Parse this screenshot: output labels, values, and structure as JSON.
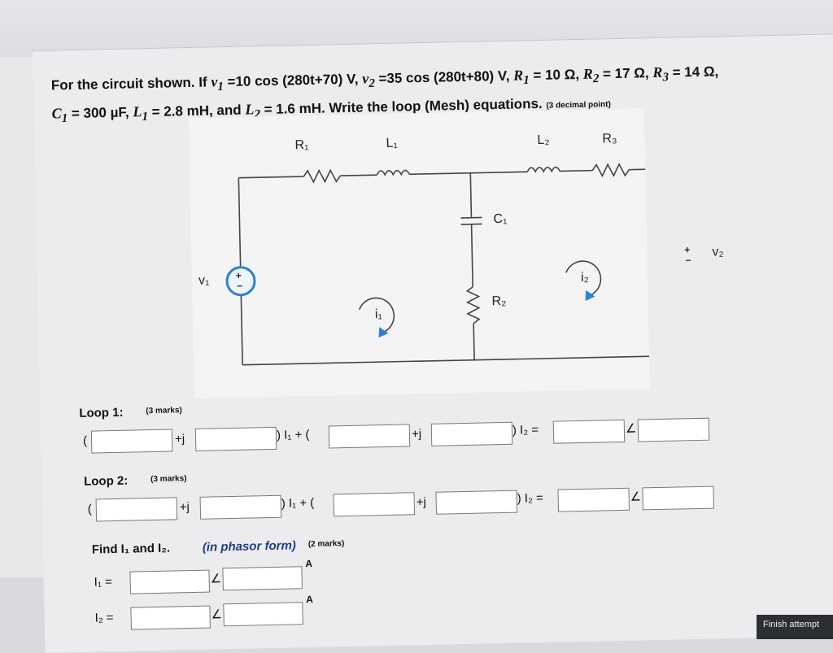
{
  "question": {
    "intro": "For the circuit shown. If",
    "v1_sym": "v",
    "v1_sub": "1",
    "v1_expr": "=10 cos (280t+70) V,",
    "v2_sym": "v",
    "v2_sub": "2",
    "v2_expr": "=35 cos (280t+80) V,",
    "R1_txt": "= 10 Ω,",
    "R2_txt": "= 17 Ω,",
    "R3_txt": "= 14 Ω,",
    "C1_txt": "= 300 µF,",
    "L1_txt": "= 2.8 mH, and",
    "L2_txt": "= 1.6 mH. Write the loop (Mesh) equations.",
    "decimal_note": "(3 decimal point)"
  },
  "circuit": {
    "R1": "R₁",
    "L1": "L₁",
    "L2": "L₂",
    "R3": "R₃",
    "C1": "C₁",
    "R2": "R₂",
    "v1": "v₁",
    "v2": "v₂",
    "i1": "i₁",
    "i2": "i₂",
    "plus": "+",
    "minus": "−"
  },
  "loop1": {
    "title": "Loop 1:",
    "marks": "(3 marks)"
  },
  "loop2": {
    "title": "Loop 2:",
    "marks": "(3 marks)"
  },
  "eq": {
    "open": "(",
    "plus_j": "+j",
    "close_i1": ") I₁ + (",
    "close_i2": ") I₂ =",
    "angle": "∠"
  },
  "find": {
    "text": "Find I₁ and I₂.",
    "phasor": "(in phasor form)",
    "marks": "(2 marks)",
    "I1": "I₁ =",
    "I2": "I₂ =",
    "unit": "A"
  },
  "finish_label": "Finish attempt"
}
